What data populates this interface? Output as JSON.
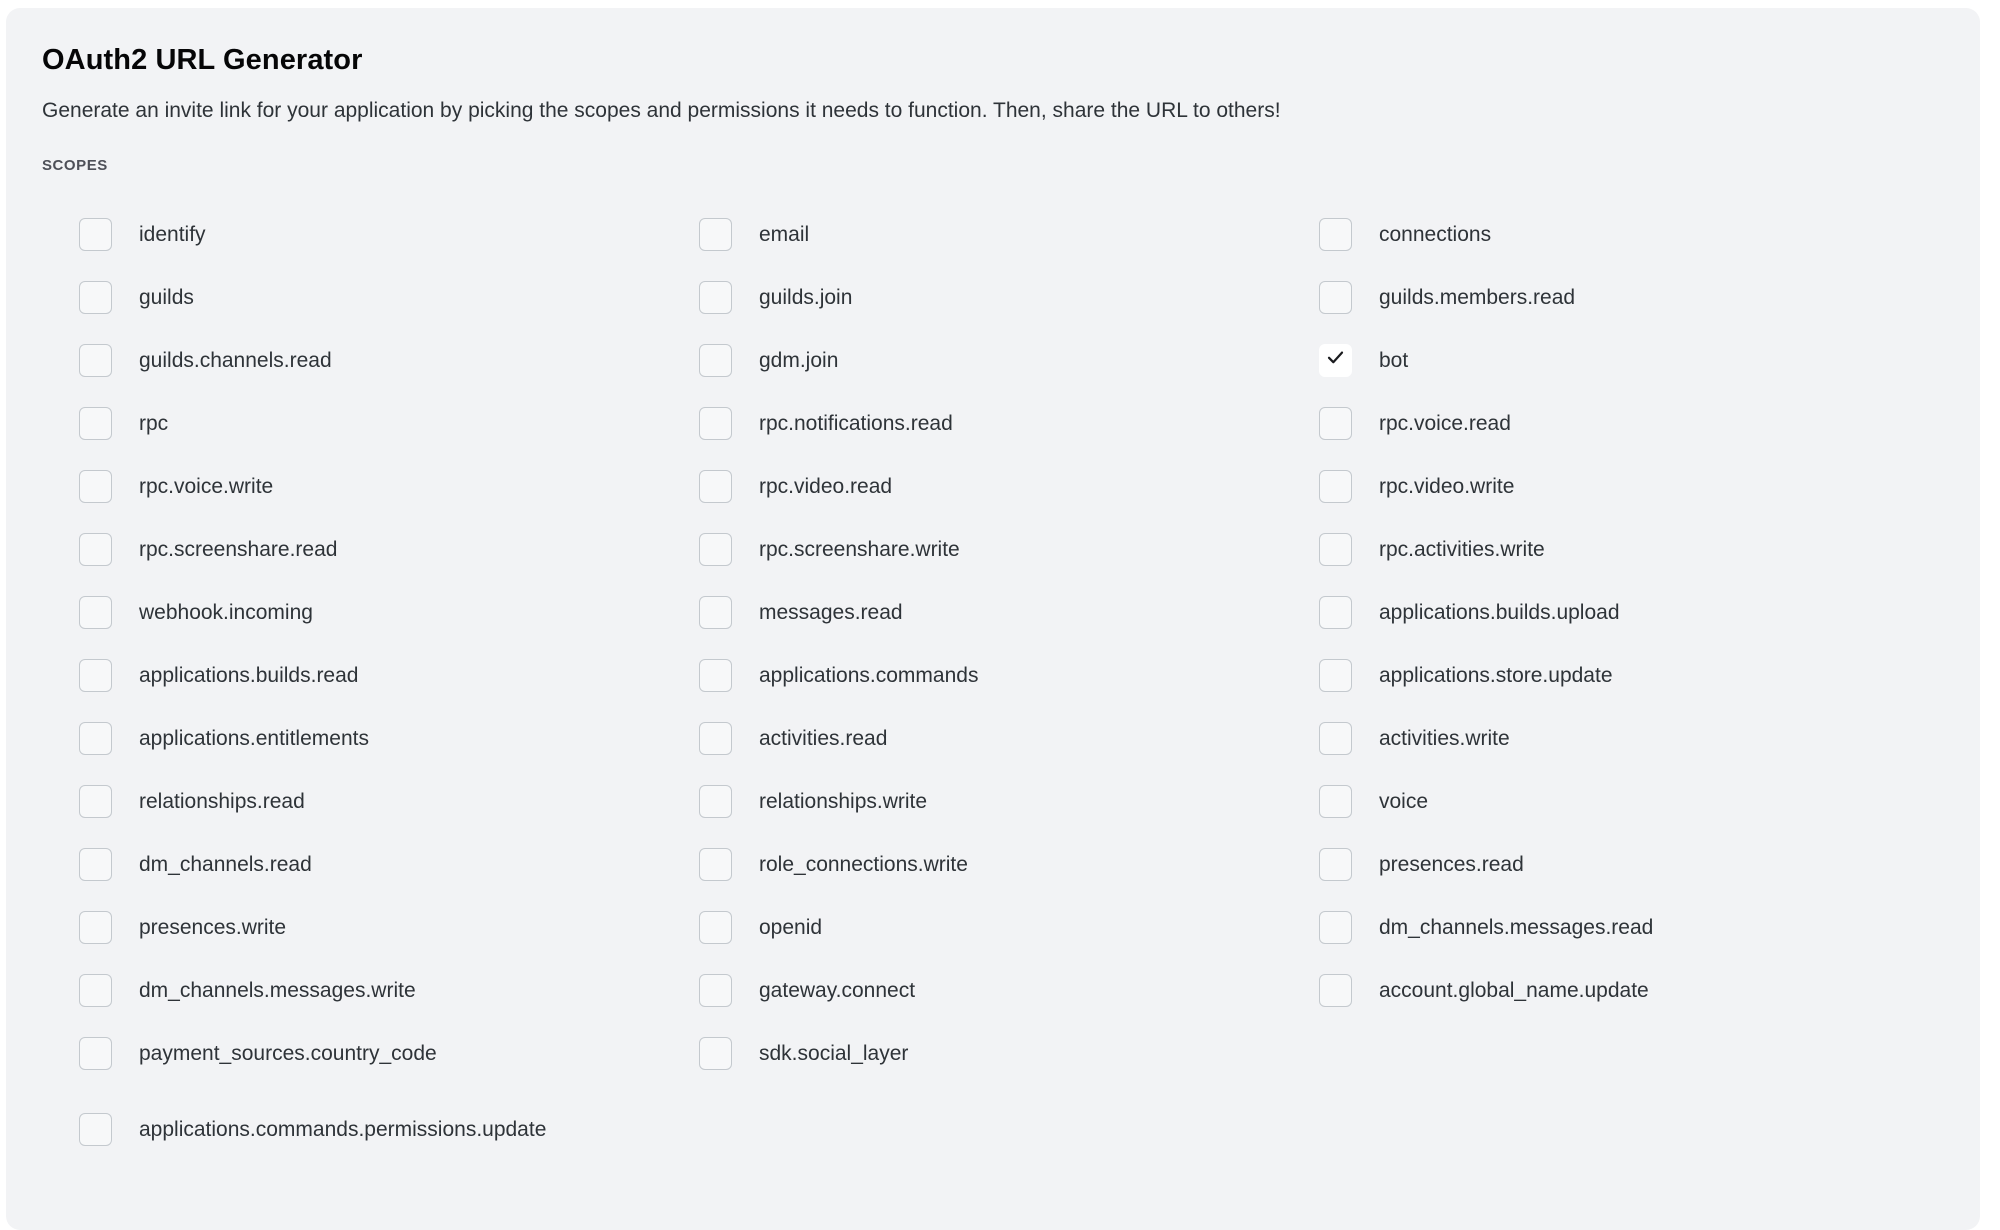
{
  "card": {
    "title": "OAuth2 URL Generator",
    "description": "Generate an invite link for your application by picking the scopes and permissions it needs to function. Then, share the URL to others!",
    "section_label": "SCOPES"
  },
  "icons": {
    "check": "check-icon"
  },
  "colors": {
    "card_background": "#f2f3f5",
    "page_background": "#ffffff",
    "title_text": "#060607",
    "body_text": "#2e3338",
    "section_label_text": "#4e5058",
    "checkbox_border": "#c4c9ce",
    "checkbox_fill": "#f7f8f9",
    "checkbox_checked_fill": "#ffffff",
    "checkmark": "#1a1b1e"
  },
  "scopes": [
    {
      "label": "identify",
      "checked": false
    },
    {
      "label": "email",
      "checked": false
    },
    {
      "label": "connections",
      "checked": false
    },
    {
      "label": "guilds",
      "checked": false
    },
    {
      "label": "guilds.join",
      "checked": false
    },
    {
      "label": "guilds.members.read",
      "checked": false
    },
    {
      "label": "guilds.channels.read",
      "checked": false
    },
    {
      "label": "gdm.join",
      "checked": false
    },
    {
      "label": "bot",
      "checked": true
    },
    {
      "label": "rpc",
      "checked": false
    },
    {
      "label": "rpc.notifications.read",
      "checked": false
    },
    {
      "label": "rpc.voice.read",
      "checked": false
    },
    {
      "label": "rpc.voice.write",
      "checked": false
    },
    {
      "label": "rpc.video.read",
      "checked": false
    },
    {
      "label": "rpc.video.write",
      "checked": false
    },
    {
      "label": "rpc.screenshare.read",
      "checked": false
    },
    {
      "label": "rpc.screenshare.write",
      "checked": false
    },
    {
      "label": "rpc.activities.write",
      "checked": false
    },
    {
      "label": "webhook.incoming",
      "checked": false
    },
    {
      "label": "messages.read",
      "checked": false
    },
    {
      "label": "applications.builds.upload",
      "checked": false
    },
    {
      "label": "applications.builds.read",
      "checked": false
    },
    {
      "label": "applications.commands",
      "checked": false
    },
    {
      "label": "applications.store.update",
      "checked": false
    },
    {
      "label": "applications.entitlements",
      "checked": false
    },
    {
      "label": "activities.read",
      "checked": false
    },
    {
      "label": "activities.write",
      "checked": false
    },
    {
      "label": "relationships.read",
      "checked": false
    },
    {
      "label": "relationships.write",
      "checked": false
    },
    {
      "label": "voice",
      "checked": false
    },
    {
      "label": "dm_channels.read",
      "checked": false
    },
    {
      "label": "role_connections.write",
      "checked": false
    },
    {
      "label": "presences.read",
      "checked": false
    },
    {
      "label": "presences.write",
      "checked": false
    },
    {
      "label": "openid",
      "checked": false
    },
    {
      "label": "dm_channels.messages.read",
      "checked": false
    },
    {
      "label": "dm_channels.messages.write",
      "checked": false
    },
    {
      "label": "gateway.connect",
      "checked": false
    },
    {
      "label": "account.global_name.update",
      "checked": false
    },
    {
      "label": "payment_sources.country_code",
      "checked": false
    },
    {
      "label": "sdk.social_layer",
      "checked": false
    }
  ],
  "scope_full_width": {
    "label": "applications.commands.permissions.update",
    "checked": false
  }
}
